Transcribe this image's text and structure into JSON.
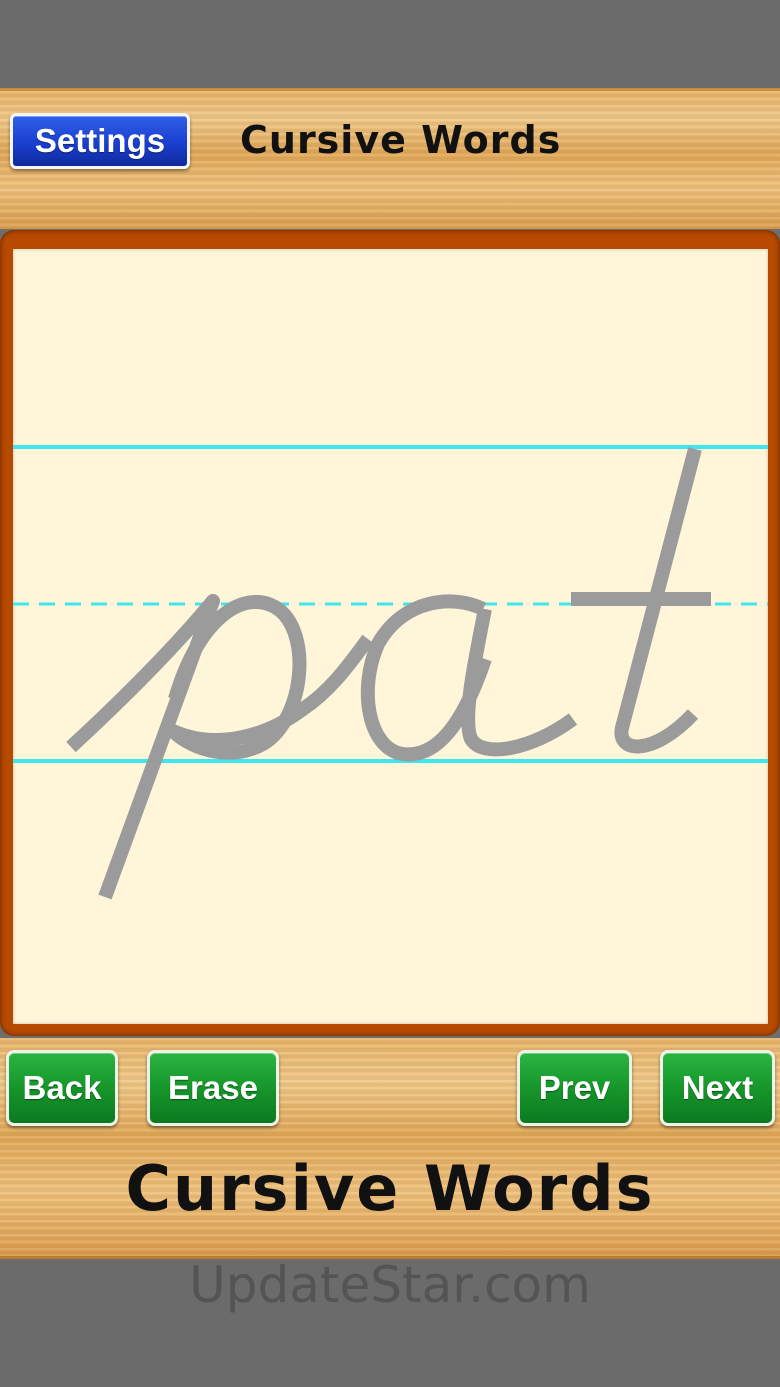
{
  "header": {
    "settings_label": "Settings",
    "title": "Cursive Words"
  },
  "practice_sheet": {
    "word": "pat",
    "guide_line_color": "#3ee6ee",
    "trace_color": "#9b9b9b",
    "paper_color": "#fff6da",
    "frame_color": "#b84a00"
  },
  "controls": {
    "back_label": "Back",
    "erase_label": "Erase",
    "prev_label": "Prev",
    "next_label": "Next"
  },
  "footer": {
    "title": "Cursive Words"
  },
  "watermark": {
    "text": "UpdateStar.com"
  },
  "colors": {
    "settings_button": "#1a3fcf",
    "nav_buttons": "#16962b",
    "wood": "#e6b46a"
  }
}
